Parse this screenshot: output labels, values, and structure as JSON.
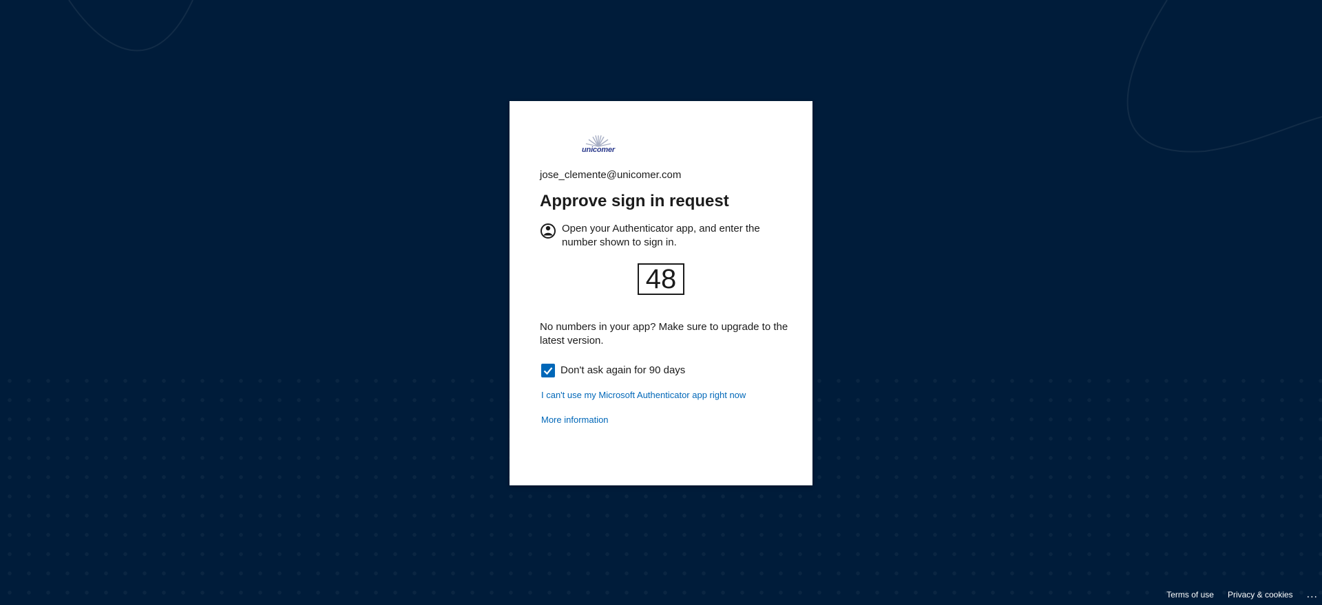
{
  "page": {
    "email": "jose_clemente@unicomer.com",
    "title": "Approve sign in request",
    "instruction": "Open your Authenticator app, and enter the number shown to sign in.",
    "code": "48",
    "upgrade_note": "No numbers in your app? Make sure to upgrade to the latest version.",
    "remember_label": "Don't ask again for 90 days",
    "remember_checked": true,
    "cant_use_link": "I can't use my Microsoft Authenticator app right now",
    "more_info_link": "More information"
  },
  "logo": {
    "text": "unicomer"
  },
  "footer": {
    "terms": "Terms of use",
    "privacy": "Privacy & cookies",
    "more": "..."
  },
  "colors": {
    "background": "#001c3a",
    "link": "#0067b8",
    "checkbox": "#0067b8",
    "text": "#1b1b1b"
  },
  "icons": {
    "authenticator": "lock-person-icon",
    "checkbox": "checkmark-icon",
    "more": "ellipsis-icon"
  }
}
